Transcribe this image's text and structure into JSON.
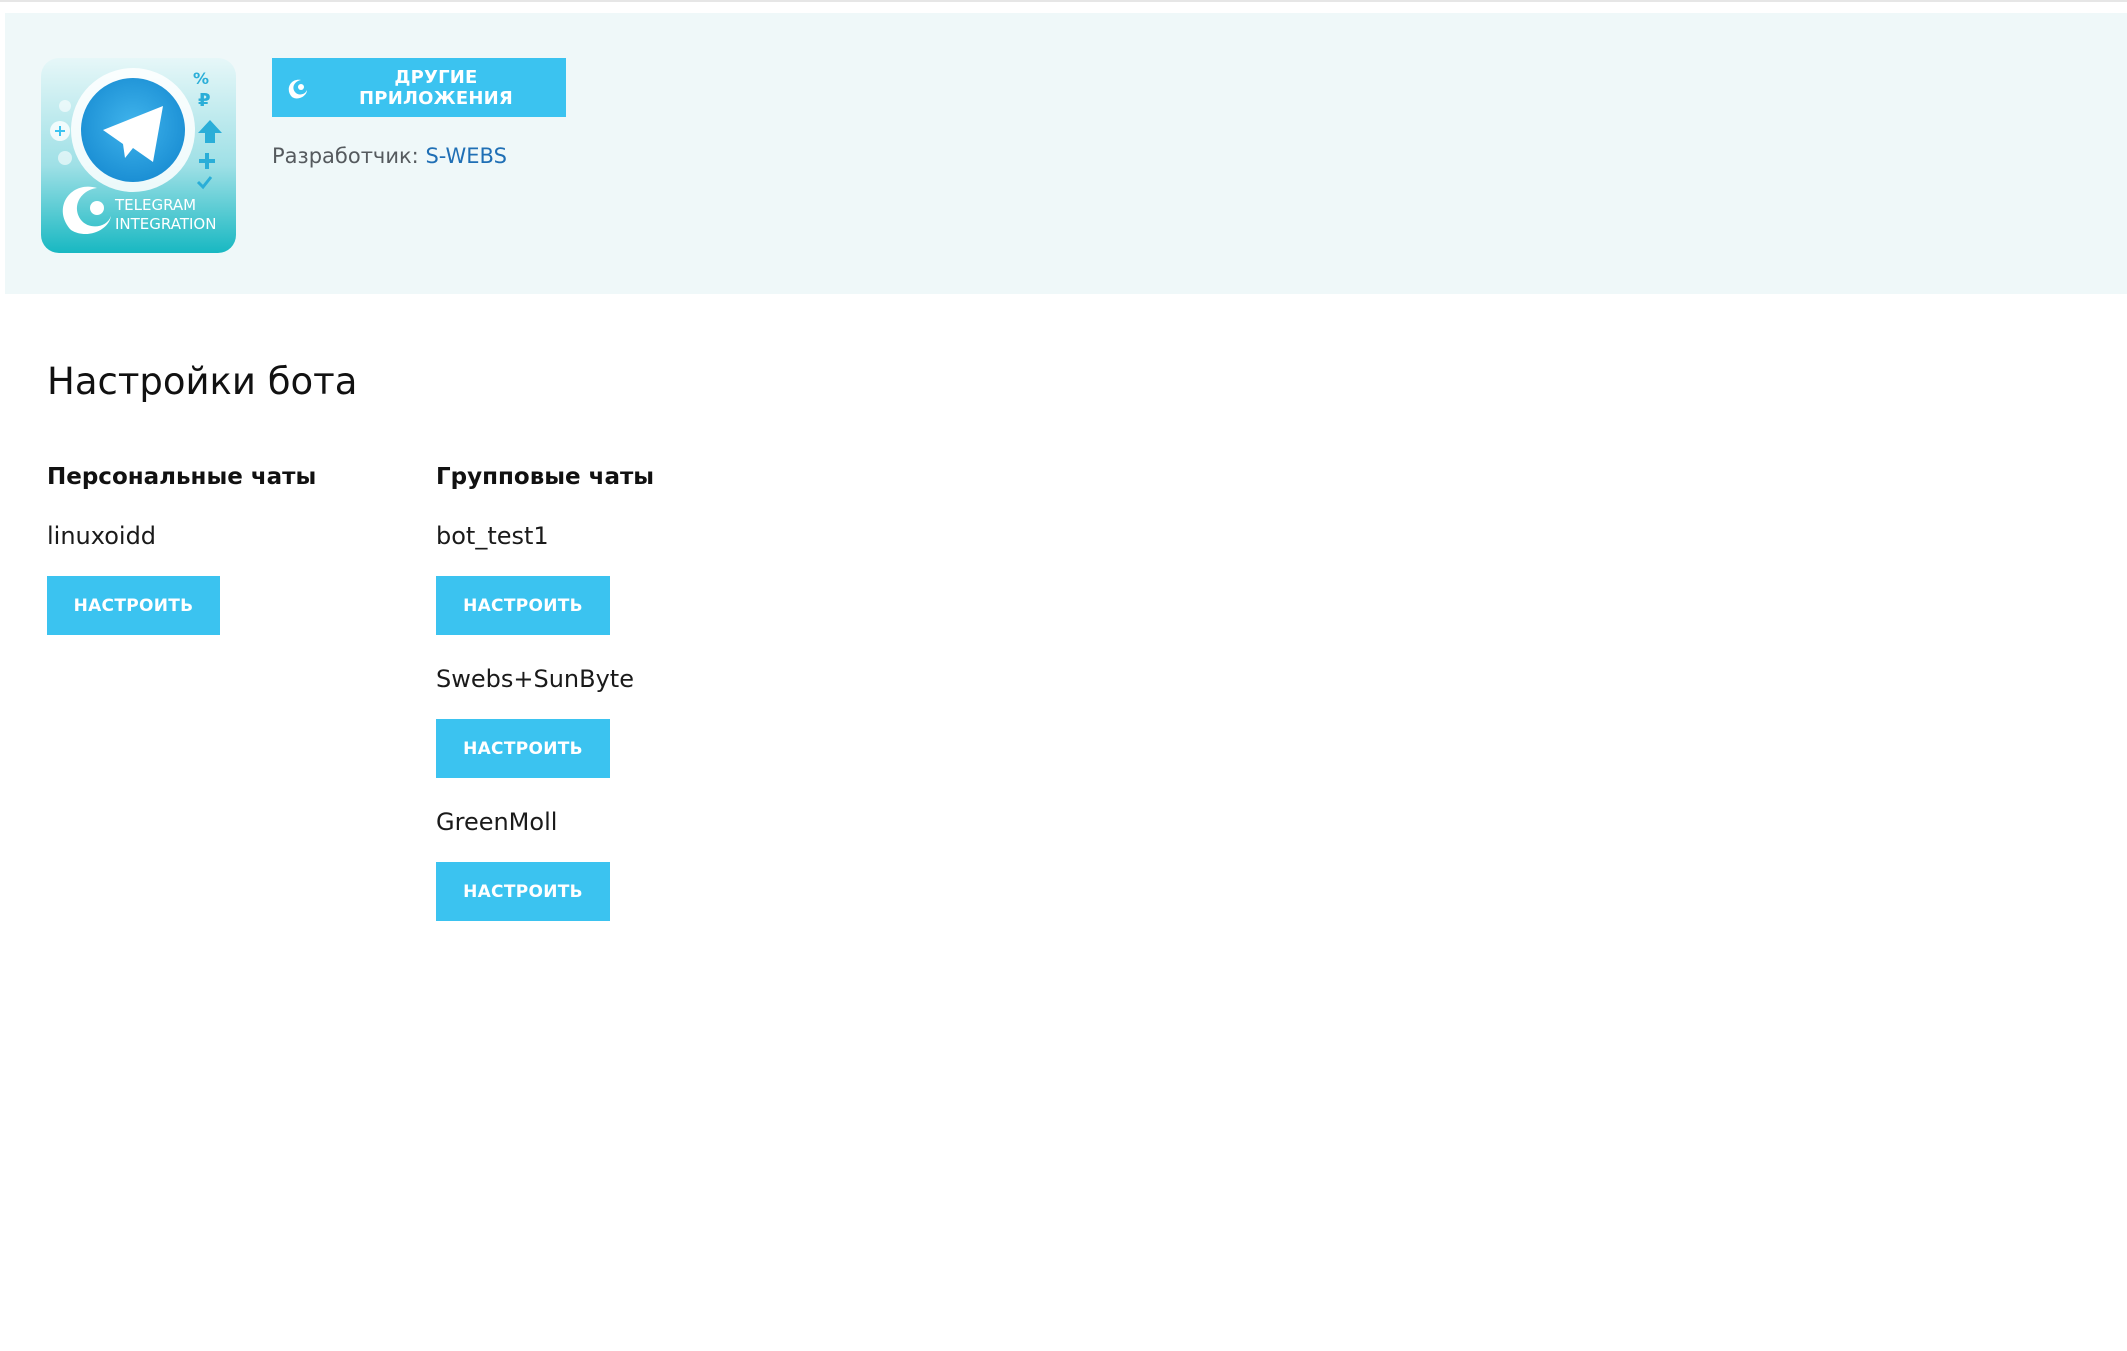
{
  "header": {
    "logo": {
      "icon": "telegram-integration-logo",
      "lines": [
        "TELEGRAM",
        "INTEGRATION"
      ]
    },
    "other_apps_button": {
      "icon": "swebs-swirl-icon",
      "label": "ДРУГИЕ ПРИЛОЖЕНИЯ"
    },
    "developer": {
      "label": "Разработчик:",
      "link_text": "S-WEBS"
    }
  },
  "main": {
    "title": "Настройки бота",
    "personal": {
      "heading": "Персональные чаты",
      "chats": [
        {
          "name": "linuxoidd",
          "button_label": "НАСТРОИТЬ"
        }
      ]
    },
    "group": {
      "heading": "Групповые чаты",
      "chats": [
        {
          "name": "bot_test1",
          "button_label": "НАСТРОИТЬ"
        },
        {
          "name": "Swebs+SunByte",
          "button_label": "НАСТРОИТЬ"
        },
        {
          "name": "GreenMoll",
          "button_label": "НАСТРОИТЬ"
        }
      ]
    }
  },
  "colors": {
    "accent": "#3bc3f0",
    "header_bg": "#eff8f9",
    "link": "#1f6fb5"
  }
}
